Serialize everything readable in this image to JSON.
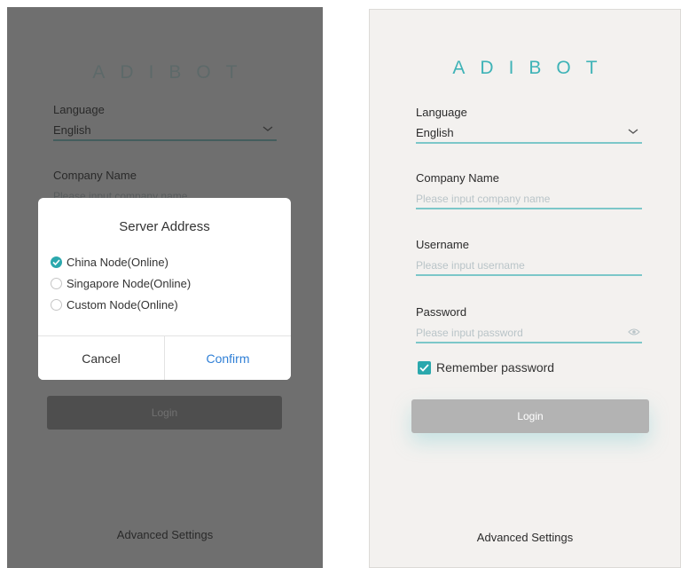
{
  "brand": {
    "logo": "ADIBOT",
    "accent_color": "#2ba8ad"
  },
  "login_form": {
    "language": {
      "label": "Language",
      "value": "English",
      "icon": "chevron-down-icon"
    },
    "company": {
      "label": "Company Name",
      "placeholder": "Please input company name"
    },
    "username": {
      "label": "Username",
      "placeholder": "Please input username"
    },
    "password": {
      "label": "Password",
      "placeholder": "Please input password",
      "icon": "eye-icon"
    },
    "remember": {
      "label": "Remember password",
      "checked": true
    },
    "login_label": "Login",
    "advanced_label": "Advanced Settings"
  },
  "server_dialog": {
    "title": "Server Address",
    "options": [
      {
        "label": "China Node(Online)",
        "selected": true
      },
      {
        "label": "Singapore Node(Online)",
        "selected": false
      },
      {
        "label": "Custom Node(Online)",
        "selected": false
      }
    ],
    "cancel_label": "Cancel",
    "confirm_label": "Confirm"
  }
}
